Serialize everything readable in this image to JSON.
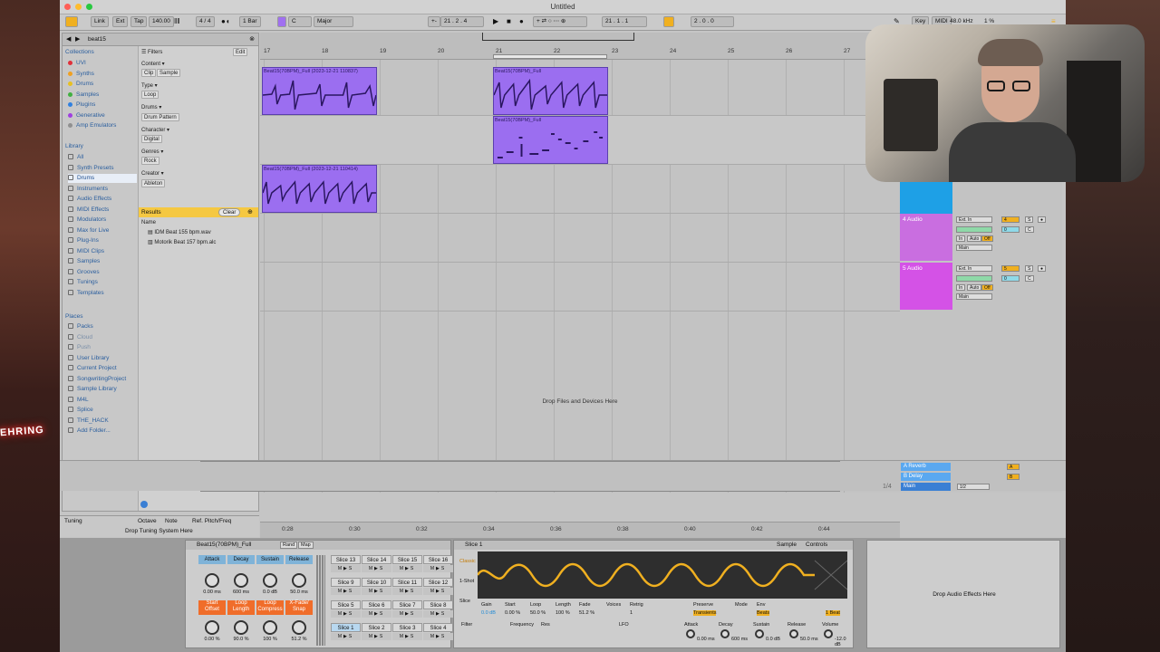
{
  "window": {
    "title": "Untitled"
  },
  "toolbar": {
    "link": "Link",
    "ext": "Ext",
    "tap": "Tap",
    "tempo": "140.00",
    "signature": "4 / 4",
    "quantize": "1 Bar",
    "key": "C",
    "scale": "Major",
    "position": "21 .  2 .  4",
    "loop_start": "21 .  1 .  1",
    "loop_length": "2 .  0 .  0",
    "key_btn": "Key",
    "midi": "MIDI",
    "sample_rate": "48.0 kHz",
    "cpu": "1 %"
  },
  "browser": {
    "search": "beat15",
    "collections_label": "Collections",
    "collections": [
      {
        "label": "UVI",
        "color": "#e0303a"
      },
      {
        "label": "Synths",
        "color": "#f0a020"
      },
      {
        "label": "Drums",
        "color": "#e8c020"
      },
      {
        "label": "Samples",
        "color": "#40b040"
      },
      {
        "label": "Plugins",
        "color": "#3080e0"
      },
      {
        "label": "Generative",
        "color": "#a040e0"
      },
      {
        "label": "Amp Emulators",
        "color": "#909090"
      }
    ],
    "library_label": "Library",
    "library": [
      "All",
      "Synth Presets",
      "Drums",
      "Instruments",
      "Audio Effects",
      "MIDI Effects",
      "Modulators",
      "Max for Live",
      "Plug-Ins",
      "MIDI Clips",
      "Samples",
      "Grooves",
      "Tunings",
      "Templates"
    ],
    "places_label": "Places",
    "places": [
      "Packs",
      "Cloud",
      "Push",
      "User Library",
      "Current Project",
      "SongwritingProject",
      "Sample Library",
      "M4L",
      "Splice",
      "THE_HACK",
      "Add Folder..."
    ],
    "filters_label": "Filters",
    "edit": "Edit",
    "filters": [
      {
        "label": "Content ▾",
        "tags": [
          "Clip",
          "Sample"
        ]
      },
      {
        "label": "Type ▾",
        "tags": [
          "Loop"
        ]
      },
      {
        "label": "Drums ▾",
        "tags": [
          "Drum Pattern"
        ]
      },
      {
        "label": "Character ▾",
        "tags": [
          "Digital"
        ]
      },
      {
        "label": "Genres ▾",
        "tags": [
          "Rock"
        ]
      },
      {
        "label": "Creator ▾",
        "tags": [
          "Ableton"
        ]
      }
    ],
    "results_label": "Results",
    "clear": "Clear",
    "name_header": "Name",
    "results": [
      "IDM Beat 155 bpm.wav",
      "Motorik Beat 157 bpm.alc"
    ],
    "tuning_label": "Tuning",
    "tuning_cols": [
      "Octave",
      "Note",
      "Ref. Pitch/Freq"
    ],
    "tuning_drop": "Drop Tuning System Here"
  },
  "arrangement": {
    "bars": [
      "17",
      "18",
      "19",
      "20",
      "21",
      "22",
      "23",
      "24",
      "25",
      "26",
      "27"
    ],
    "clips": [
      {
        "title": "Beat15(70BPM)_Full (2023-12-21 110837)"
      },
      {
        "title": "Beat15(70BPM)_Full"
      },
      {
        "title": "Beat15(70BPM)_Full"
      },
      {
        "title": "Beat15(70BPM)_Full (2023-12-21 110414)"
      }
    ],
    "drop_text": "Drop Files and Devices Here",
    "times": [
      "0:28",
      "0:30",
      "0:32",
      "0:34",
      "0:36",
      "0:38",
      "0:40",
      "0:42",
      "0:44"
    ],
    "zoom": "1/4"
  },
  "mixer": {
    "tracks": [
      {
        "name": "4 Audio",
        "color": "#c96ee0"
      },
      {
        "name": "5 Audio",
        "color": "#d452e6"
      }
    ],
    "input": "Ext. In",
    "monitor": [
      "In",
      "Auto",
      "Off"
    ],
    "output": "Main",
    "returns": [
      {
        "name": "A Reverb",
        "label": "A"
      },
      {
        "name": "B Delay",
        "label": "B"
      },
      {
        "name": "Main",
        "label": "1/2"
      }
    ]
  },
  "devices": {
    "drum_title": "Beat15(70BPM)_Full",
    "rand": "Rand",
    "map": "Map",
    "env_labels": [
      "Attack",
      "Decay",
      "Sustain",
      "Release"
    ],
    "env_values": [
      "0.00 ms",
      "600 ms",
      "0.0 dB",
      "50.0 ms"
    ],
    "loop_labels": [
      "Start Offset",
      "Loop Length",
      "Loop Compress",
      "X-Fade/ Snap"
    ],
    "loop_values": [
      "0.00 %",
      "90.0 %",
      "100 %",
      "51.2 %"
    ],
    "slices": [
      [
        "Slice 13",
        "Slice 14",
        "Slice 15",
        "Slice 16"
      ],
      [
        "Slice 9",
        "Slice 10",
        "Slice 11",
        "Slice 12"
      ],
      [
        "Slice 5",
        "Slice 6",
        "Slice 7",
        "Slice 8"
      ],
      [
        "Slice 1",
        "Slice 2",
        "Slice 3",
        "Slice 4"
      ]
    ],
    "sampler_title": "Slice 1",
    "sample_tab": "Sample",
    "controls_tab": "Controls",
    "modes": [
      "Classic",
      "1-Shot",
      "Slice"
    ],
    "params": [
      "Gain",
      "Start",
      "Loop",
      "Length",
      "Fade",
      "Voices",
      "Retrig",
      "Preserve",
      "Mode",
      "Env"
    ],
    "param_values": [
      "0.0 dB",
      "0.00 %",
      "50.0 %",
      "100 %",
      "51.2 %",
      "1",
      "Transients",
      "Beats",
      "1 Beat"
    ],
    "filter": "Filter",
    "freq": "Frequency",
    "res": "Res",
    "lfo": "LFO",
    "amp_labels": [
      "Attack",
      "Decay",
      "Sustain",
      "Release",
      "Volume"
    ],
    "amp_values": [
      "0.00 ms",
      "600 ms",
      "0.0 dB",
      "50.0 ms",
      "-12.0 dB"
    ],
    "drop_effects": "Drop Audio Effects Here"
  }
}
